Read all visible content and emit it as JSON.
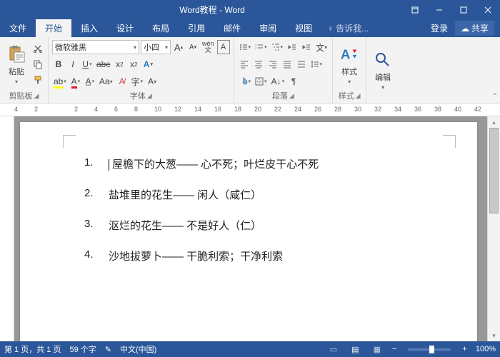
{
  "window": {
    "title": "Word教程 - Word"
  },
  "tabs": {
    "file": "文件",
    "home": "开始",
    "insert": "插入",
    "design": "设计",
    "layout": "布局",
    "references": "引用",
    "mail": "邮件",
    "review": "审阅",
    "view": "视图",
    "tellme": "告诉我...",
    "login": "登录",
    "share": "共享"
  },
  "ribbon": {
    "clipboard": {
      "label": "剪贴板",
      "paste": "粘贴"
    },
    "font": {
      "label": "字体",
      "name": "微软雅黑",
      "size": "小四",
      "wen": "wén"
    },
    "paragraph": {
      "label": "段落"
    },
    "styles": {
      "label": "样式",
      "btn": "样式"
    },
    "editing": {
      "label": "",
      "btn": "编辑"
    }
  },
  "ruler": {
    "nums": [
      "4",
      "2",
      "",
      "2",
      "4",
      "6",
      "8",
      "10",
      "12",
      "14",
      "16",
      "18",
      "20",
      "22",
      "24",
      "26",
      "28",
      "30",
      "32",
      "34",
      "36",
      "38",
      "40",
      "42"
    ]
  },
  "document": {
    "items": [
      {
        "n": "1.",
        "text": "屋檐下的大葱—— 心不死；叶烂皮干心不死"
      },
      {
        "n": "2.",
        "text": "盐堆里的花生—— 闲人（咸仁）"
      },
      {
        "n": "3.",
        "text": "沤烂的花生—— 不是好人（仁）"
      },
      {
        "n": "4.",
        "text": "沙地拔萝卜—— 干脆利索；干净利索"
      }
    ]
  },
  "status": {
    "page": "第 1 页，共 1 页",
    "words": "59 个字",
    "lang": "中文(中国)",
    "zoom": "100%"
  }
}
